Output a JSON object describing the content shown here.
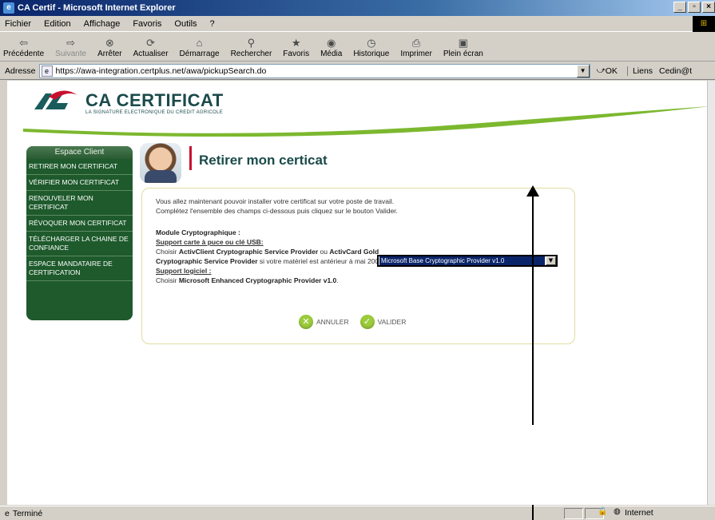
{
  "window": {
    "title": "CA Certif - Microsoft Internet Explorer"
  },
  "menu": [
    "Fichier",
    "Edition",
    "Affichage",
    "Favoris",
    "Outils",
    "?"
  ],
  "toolbar": [
    {
      "label": "Précédente",
      "icon": "back-icon"
    },
    {
      "label": "Suivante",
      "icon": "forward-icon"
    },
    {
      "label": "Arrêter",
      "icon": "stop-icon"
    },
    {
      "label": "Actualiser",
      "icon": "refresh-icon"
    },
    {
      "label": "Démarrage",
      "icon": "home-icon"
    },
    {
      "label": "Rechercher",
      "icon": "search-icon"
    },
    {
      "label": "Favoris",
      "icon": "favorites-icon"
    },
    {
      "label": "Média",
      "icon": "media-icon"
    },
    {
      "label": "Historique",
      "icon": "history-icon"
    },
    {
      "label": "Imprimer",
      "icon": "print-icon"
    },
    {
      "label": "Plein écran",
      "icon": "fullscreen-icon"
    }
  ],
  "address": {
    "label": "Adresse",
    "url": "https://awa-integration.certplus.net/awa/pickupSearch.do",
    "go": "OK",
    "links": "Liens",
    "link1": "Cedin@t"
  },
  "page": {
    "logo": {
      "name": "CA CERTIFICAT",
      "tagline": "LA SIGNATURE ELECTRONIQUE DU CREDIT AGRICOLE"
    },
    "sidebar": {
      "heading": "Espace Client",
      "items": [
        "RETIRER MON CERTIFICAT",
        "VÉRIFIER MON CERTIFICAT",
        "RENOUVELER MON CERTIFICAT",
        "RÉVOQUER MON CERTIFICAT",
        "TÉLÉCHARGER LA CHAINE DE CONFIANCE",
        "ESPACE MANDATAIRE DE CERTIFICATION"
      ]
    },
    "title": "Retirer mon certicat",
    "intro1": "Vous allez maintenant pouvoir installer votre certificat sur votre poste de travail.",
    "intro2": "Complétez l'ensemble des champs ci-dessous puis cliquez sur le bouton Valider.",
    "module_label": "Module Cryptographique :",
    "usb_heading": "Support carte à puce ou clé USB:",
    "usb_choose": "Choisir",
    "usb_opt1": "ActivClient Cryptographic Service Provider",
    "usb_or": "ou",
    "usb_opt2": "ActivCard Gold Cryptographic Service Provider",
    "usb_tail": "si votre matériel est antérieur à mai 2007.",
    "soft_heading": "Support logiciel :",
    "soft_choose": "Choisir",
    "soft_opt": "Microsoft Enhanced Cryptographic Provider v1.0",
    "soft_end": ".",
    "select_value": "Microsoft Base Cryptographic Provider v1.0",
    "cancel": "ANNULER",
    "validate": "VALIDER"
  },
  "status": {
    "text": "Terminé",
    "zone": "Internet"
  }
}
